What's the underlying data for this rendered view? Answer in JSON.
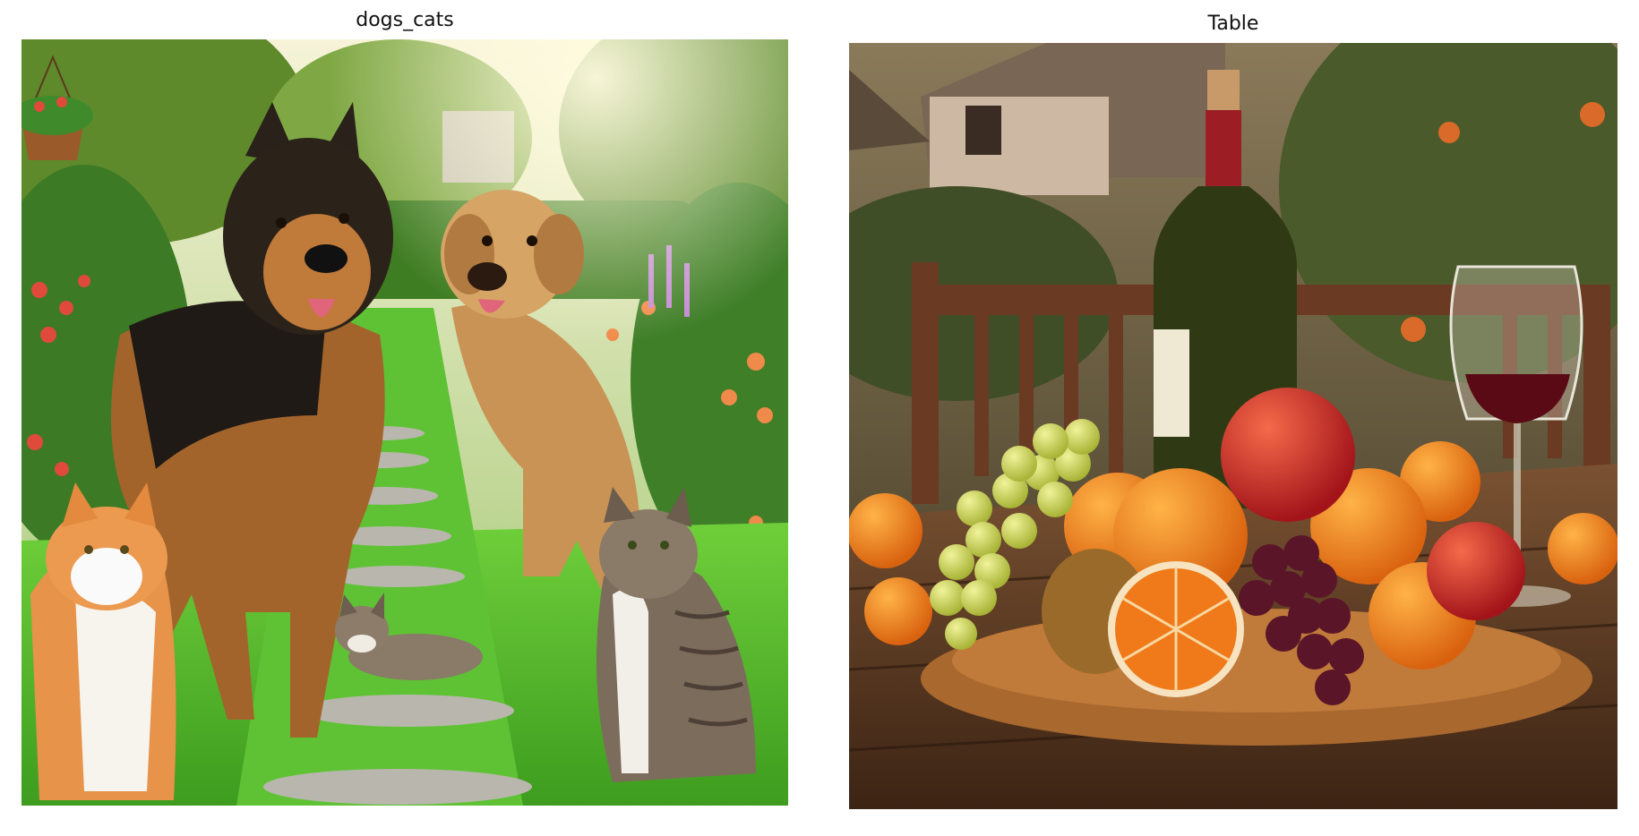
{
  "panels": [
    {
      "title": "dogs_cats"
    },
    {
      "title": "Table"
    }
  ]
}
